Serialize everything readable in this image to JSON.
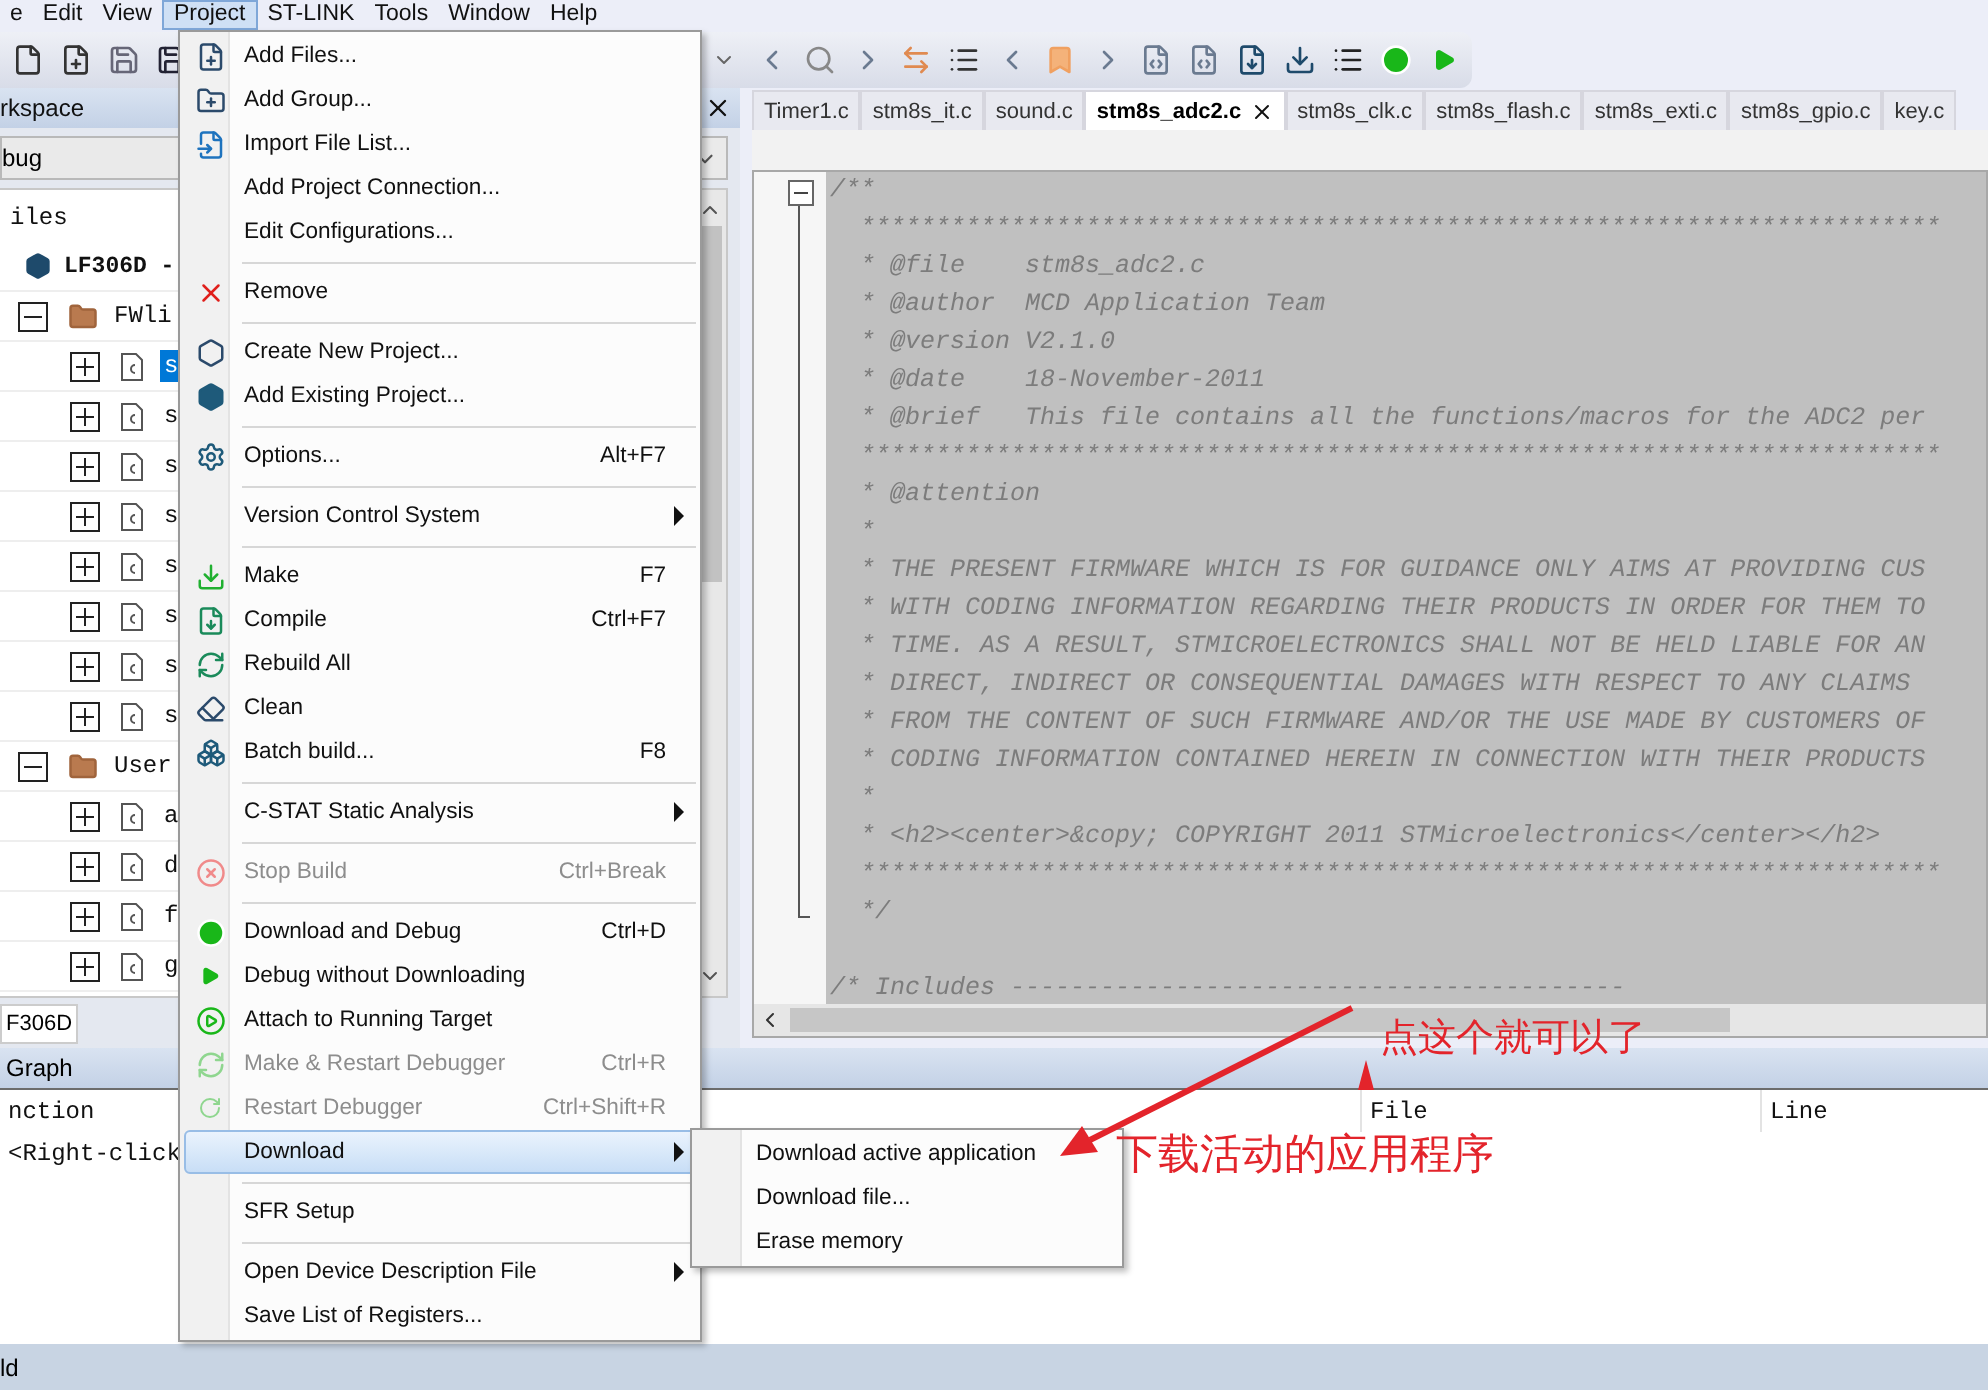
{
  "menubar": [
    {
      "label": "e",
      "selected": false
    },
    {
      "label": "Edit",
      "selected": false
    },
    {
      "label": "View",
      "selected": false
    },
    {
      "label": "Project",
      "selected": true
    },
    {
      "label": "ST-LINK",
      "selected": false
    },
    {
      "label": "Tools",
      "selected": false
    },
    {
      "label": "Window",
      "selected": false
    },
    {
      "label": "Help",
      "selected": false
    }
  ],
  "workspace": {
    "title": "rkspace",
    "configuration": "bug",
    "tree_header": "iles",
    "tree": [
      {
        "label": "LF306D -",
        "expanded": true,
        "children": [
          {
            "label": "FWli",
            "expanded": true,
            "children": [
              {
                "label": "s",
                "expanded": false,
                "selected": true
              },
              {
                "label": "s",
                "expanded": false,
                "selected": false
              },
              {
                "label": "s",
                "expanded": false,
                "selected": false
              },
              {
                "label": "s",
                "expanded": false,
                "selected": false
              },
              {
                "label": "s",
                "expanded": false,
                "selected": false
              },
              {
                "label": "s",
                "expanded": false,
                "selected": false
              },
              {
                "label": "s",
                "expanded": false,
                "selected": false
              },
              {
                "label": "s",
                "expanded": false,
                "selected": false
              }
            ]
          },
          {
            "label": "User",
            "expanded": true,
            "children": [
              {
                "label": "a",
                "expanded": false,
                "selected": false
              },
              {
                "label": "d",
                "expanded": false,
                "selected": false
              },
              {
                "label": "f",
                "expanded": false,
                "selected": false
              },
              {
                "label": "g",
                "expanded": false,
                "selected": false
              }
            ]
          }
        ]
      }
    ],
    "bottom_tab": "F306D"
  },
  "editor": {
    "tabs": [
      {
        "label": "Timer1.c",
        "selected": false
      },
      {
        "label": "stm8s_it.c",
        "selected": false
      },
      {
        "label": "sound.c",
        "selected": false
      },
      {
        "label": "stm8s_adc2.c",
        "selected": true
      },
      {
        "label": "stm8s_clk.c",
        "selected": false
      },
      {
        "label": "stm8s_flash.c",
        "selected": false
      },
      {
        "label": "stm8s_exti.c",
        "selected": false
      },
      {
        "label": "stm8s_gpio.c",
        "selected": false
      },
      {
        "label": "key.c",
        "selected": false
      }
    ],
    "lines": [
      "/**",
      "  ************************************************************************",
      "  * @file    stm8s_adc2.c",
      "  * @author  MCD Application Team",
      "  * @version V2.1.0",
      "  * @date    18-November-2011",
      "  * @brief   This file contains all the functions/macros for the ADC2 per",
      "  ************************************************************************",
      "  * @attention",
      "  *",
      "  * THE PRESENT FIRMWARE WHICH IS FOR GUIDANCE ONLY AIMS AT PROVIDING CUS",
      "  * WITH CODING INFORMATION REGARDING THEIR PRODUCTS IN ORDER FOR THEM TO",
      "  * TIME. AS A RESULT, STMICROELECTRONICS SHALL NOT BE HELD LIABLE FOR AN",
      "  * DIRECT, INDIRECT OR CONSEQUENTIAL DAMAGES WITH RESPECT TO ANY CLAIMS",
      "  * FROM THE CONTENT OF SUCH FIRMWARE AND/OR THE USE MADE BY CUSTOMERS OF",
      "  * CODING INFORMATION CONTAINED HEREIN IN CONNECTION WITH THEIR PRODUCTS",
      "  *",
      "  * <h2><center>&copy; COPYRIGHT 2011 STMicroelectronics</center></h2>",
      "  ************************************************************************",
      "  */",
      "/* Includes -----------------------------------------"
    ]
  },
  "output_panel": {
    "title": "Graph",
    "columns": [
      "nction",
      "File",
      "Line"
    ],
    "rows": [
      [
        "<Right-click"
      ]
    ]
  },
  "status_bar": "ld",
  "project_menu": [
    {
      "kind": "item",
      "label": "Add Files...",
      "disabled": false,
      "submenu": false,
      "selected": false
    },
    {
      "kind": "item",
      "label": "Add Group...",
      "disabled": false,
      "submenu": false,
      "selected": false
    },
    {
      "kind": "item",
      "label": "Import File List...",
      "disabled": false,
      "submenu": false,
      "selected": false
    },
    {
      "kind": "item",
      "label": "Add Project Connection...",
      "disabled": false,
      "submenu": false,
      "selected": false
    },
    {
      "kind": "item",
      "label": "Edit Configurations...",
      "disabled": false,
      "submenu": false,
      "selected": false
    },
    {
      "kind": "separator"
    },
    {
      "kind": "item",
      "label": "Remove",
      "disabled": false,
      "submenu": false,
      "selected": false
    },
    {
      "kind": "separator"
    },
    {
      "kind": "item",
      "label": "Create New Project...",
      "disabled": false,
      "submenu": false,
      "selected": false
    },
    {
      "kind": "item",
      "label": "Add Existing Project...",
      "disabled": false,
      "submenu": false,
      "selected": false
    },
    {
      "kind": "separator"
    },
    {
      "kind": "item",
      "label": "Options...",
      "shortcut": "Alt+F7",
      "disabled": false,
      "submenu": false,
      "selected": false
    },
    {
      "kind": "separator"
    },
    {
      "kind": "item",
      "label": "Version Control System",
      "disabled": false,
      "submenu": true,
      "selected": false
    },
    {
      "kind": "separator"
    },
    {
      "kind": "item",
      "label": "Make",
      "shortcut": "F7",
      "disabled": false,
      "submenu": false,
      "selected": false
    },
    {
      "kind": "item",
      "label": "Compile",
      "shortcut": "Ctrl+F7",
      "disabled": false,
      "submenu": false,
      "selected": false
    },
    {
      "kind": "item",
      "label": "Rebuild All",
      "disabled": false,
      "submenu": false,
      "selected": false
    },
    {
      "kind": "item",
      "label": "Clean",
      "disabled": false,
      "submenu": false,
      "selected": false
    },
    {
      "kind": "item",
      "label": "Batch build...",
      "shortcut": "F8",
      "disabled": false,
      "submenu": false,
      "selected": false
    },
    {
      "kind": "separator"
    },
    {
      "kind": "item",
      "label": "C-STAT Static Analysis",
      "disabled": false,
      "submenu": true,
      "selected": false
    },
    {
      "kind": "separator"
    },
    {
      "kind": "item",
      "label": "Stop Build",
      "shortcut": "Ctrl+Break",
      "disabled": true,
      "submenu": false,
      "selected": false
    },
    {
      "kind": "separator"
    },
    {
      "kind": "item",
      "label": "Download and Debug",
      "shortcut": "Ctrl+D",
      "disabled": false,
      "submenu": false,
      "selected": false
    },
    {
      "kind": "item",
      "label": "Debug without Downloading",
      "disabled": false,
      "submenu": false,
      "selected": false
    },
    {
      "kind": "item",
      "label": "Attach to Running Target",
      "disabled": false,
      "submenu": false,
      "selected": false
    },
    {
      "kind": "item",
      "label": "Make & Restart Debugger",
      "shortcut": "Ctrl+R",
      "disabled": true,
      "submenu": false,
      "selected": false
    },
    {
      "kind": "item",
      "label": "Restart Debugger",
      "shortcut": "Ctrl+Shift+R",
      "disabled": true,
      "submenu": false,
      "selected": false
    },
    {
      "kind": "item",
      "label": "Download",
      "disabled": false,
      "submenu": true,
      "selected": true
    },
    {
      "kind": "separator"
    },
    {
      "kind": "item",
      "label": "SFR Setup",
      "disabled": false,
      "submenu": false,
      "selected": false
    },
    {
      "kind": "separator"
    },
    {
      "kind": "item",
      "label": "Open Device Description File",
      "disabled": false,
      "submenu": true,
      "selected": false
    },
    {
      "kind": "item",
      "label": "Save List of Registers...",
      "disabled": false,
      "submenu": false,
      "selected": false
    }
  ],
  "download_submenu": [
    {
      "label": "Download active application"
    },
    {
      "label": "Download file..."
    },
    {
      "label": "Erase memory"
    }
  ],
  "annotations": [
    {
      "text": "点这个就可以了"
    },
    {
      "text": "下载活动的应用程序"
    }
  ]
}
